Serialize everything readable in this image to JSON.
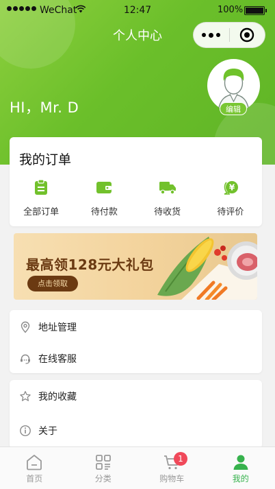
{
  "status_bar": {
    "carrier": "WeChat",
    "time": "12:47",
    "battery": "100%"
  },
  "nav": {
    "title": "个人中心"
  },
  "user": {
    "greeting": "HI，Mr. D",
    "edit_label": "编辑"
  },
  "orders": {
    "title": "我的订单",
    "items": [
      {
        "label": "全部订单",
        "icon": "clipboard-icon"
      },
      {
        "label": "待付款",
        "icon": "wallet-icon"
      },
      {
        "label": "待收货",
        "icon": "truck-icon"
      },
      {
        "label": "待评价",
        "icon": "yen-badge-icon"
      }
    ]
  },
  "banner": {
    "title": "最高领128元大礼包",
    "button": "点击领取"
  },
  "menu1": [
    {
      "label": "地址管理",
      "icon": "location-icon"
    },
    {
      "label": "在线客服",
      "icon": "headset-icon"
    }
  ],
  "menu2": [
    {
      "label": "我的收藏",
      "icon": "star-icon"
    },
    {
      "label": "关于",
      "icon": "info-icon"
    }
  ],
  "tabbar": {
    "items": [
      {
        "label": "首页",
        "icon": "home-icon",
        "active": false
      },
      {
        "label": "分类",
        "icon": "category-icon",
        "active": false
      },
      {
        "label": "购物车",
        "icon": "cart-icon",
        "active": false,
        "badge": "1"
      },
      {
        "label": "我的",
        "icon": "user-icon",
        "active": true
      }
    ]
  },
  "colors": {
    "brand_green": "#6bbf2a",
    "active_tab": "#37b24d",
    "badge_red": "#f0495a"
  }
}
